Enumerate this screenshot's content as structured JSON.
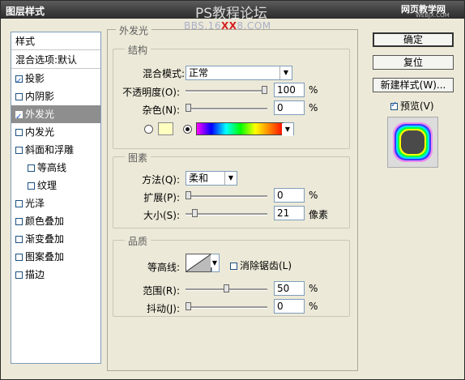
{
  "window": {
    "title": "图层样式",
    "watermark": "PS教程论坛",
    "watermark_sub_a": "BBS.16",
    "watermark_sub_red": "XX",
    "watermark_sub_b": "8.COM",
    "corner_logo": "网页教学网",
    "corner_logo_sub": "WEBJX.COM"
  },
  "styles_panel": {
    "header": "样式",
    "blend_defaults": "混合选项:默认",
    "items": [
      {
        "label": "投影",
        "checked": true
      },
      {
        "label": "内阴影",
        "checked": false
      },
      {
        "label": "外发光",
        "checked": true,
        "selected": true
      },
      {
        "label": "内发光",
        "checked": false
      },
      {
        "label": "斜面和浮雕",
        "checked": false
      },
      {
        "label": "等高线",
        "checked": false,
        "indent": true
      },
      {
        "label": "纹理",
        "checked": false,
        "indent": true
      },
      {
        "label": "光泽",
        "checked": false
      },
      {
        "label": "颜色叠加",
        "checked": false
      },
      {
        "label": "渐变叠加",
        "checked": false
      },
      {
        "label": "图案叠加",
        "checked": false
      },
      {
        "label": "描边",
        "checked": false
      }
    ]
  },
  "outer_glow": {
    "title": "外发光",
    "structure": {
      "title": "结构",
      "blend_mode_label": "混合模式:",
      "blend_mode_value": "正常",
      "opacity_label": "不透明度(O):",
      "opacity_value": "100",
      "opacity_fraction": 1.0,
      "noise_label": "杂色(N):",
      "noise_value": "0",
      "noise_fraction": 0.0,
      "percent": "%",
      "swatch_color": "#ffffc0",
      "color_mode": "gradient"
    },
    "elements": {
      "title": "图素",
      "technique_label": "方法(Q):",
      "technique_value": "柔和",
      "spread_label": "扩展(P):",
      "spread_value": "0",
      "spread_fraction": 0.0,
      "size_label": "大小(S):",
      "size_value": "21",
      "size_fraction": 0.084,
      "percent": "%",
      "pixels": "像素"
    },
    "quality": {
      "title": "品质",
      "contour_label": "等高线:",
      "antialias_label": "消除锯齿(L)",
      "antialias_checked": false,
      "range_label": "范围(R):",
      "range_value": "50",
      "range_fraction": 0.5,
      "jitter_label": "抖动(J):",
      "jitter_value": "0",
      "jitter_fraction": 0.0,
      "percent": "%"
    }
  },
  "buttons": {
    "ok": "确定",
    "reset": "复位",
    "new_style": "新建样式(W)..."
  },
  "preview": {
    "label": "预览(V)",
    "checked": true
  }
}
